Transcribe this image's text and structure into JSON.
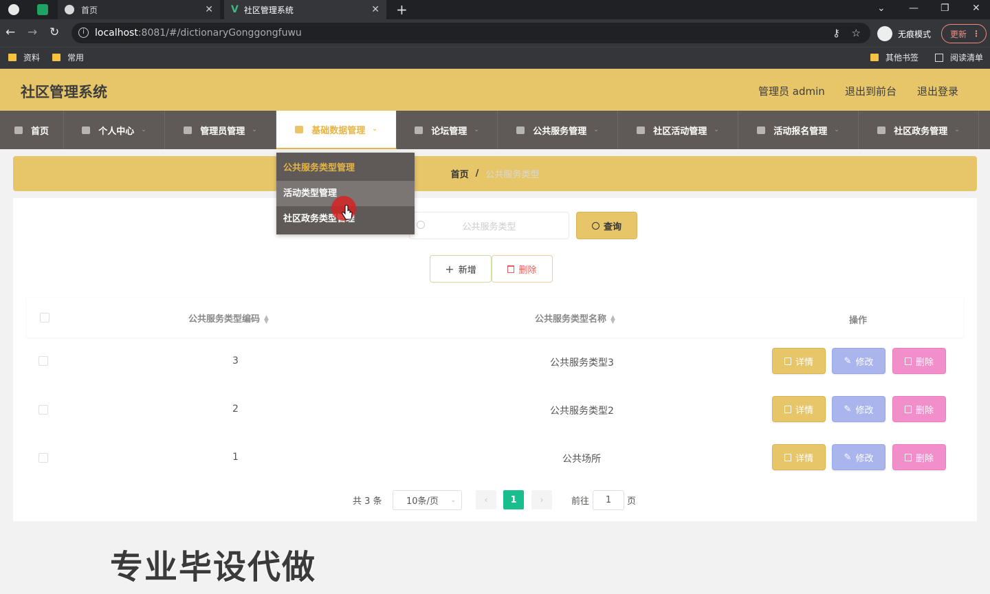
{
  "browser": {
    "tabs": [
      {
        "title": "首页"
      },
      {
        "title": "社区管理系统"
      }
    ],
    "url_host": "localhost",
    "url_rest": ":8081/#/dictionaryGonggongfuwu",
    "incognito_label": "无痕模式",
    "update_label": "更新",
    "bookmarks": [
      "资料",
      "常用"
    ],
    "bookmarks_right": [
      "其他书签",
      "阅读清单"
    ]
  },
  "header": {
    "title": "社区管理系统",
    "user": "管理员 admin",
    "back_to_front": "退出到前台",
    "logout": "退出登录"
  },
  "menu": [
    {
      "label": "首页"
    },
    {
      "label": "个人中心"
    },
    {
      "label": "管理员管理"
    },
    {
      "label": "基础数据管理"
    },
    {
      "label": "论坛管理"
    },
    {
      "label": "公共服务管理"
    },
    {
      "label": "社区活动管理"
    },
    {
      "label": "活动报名管理"
    },
    {
      "label": "社区政务管理"
    }
  ],
  "dropdown": [
    {
      "label": "公共服务类型管理"
    },
    {
      "label": "活动类型管理"
    },
    {
      "label": "社区政务类型管理"
    }
  ],
  "breadcrumb": {
    "home": "首页",
    "sep": "/",
    "current": "公共服务类型"
  },
  "search": {
    "placeholder": "公共服务类型",
    "query_label": "查询"
  },
  "toolbar": {
    "add_label": "新增",
    "delete_label": "删除"
  },
  "table": {
    "columns": [
      "公共服务类型编码",
      "公共服务类型名称",
      "操作"
    ],
    "rows": [
      {
        "code": "3",
        "name": "公共服务类型3"
      },
      {
        "code": "2",
        "name": "公共服务类型2"
      },
      {
        "code": "1",
        "name": "公共场所"
      }
    ],
    "actions": {
      "detail": "详情",
      "edit": "修改",
      "remove": "删除"
    }
  },
  "pagination": {
    "total": "共 3 条",
    "page_size": "10条/页",
    "current_page": "1",
    "goto_prefix": "前往",
    "goto_value": "1",
    "goto_suffix": "页"
  },
  "watermark": "专业毕设代做"
}
